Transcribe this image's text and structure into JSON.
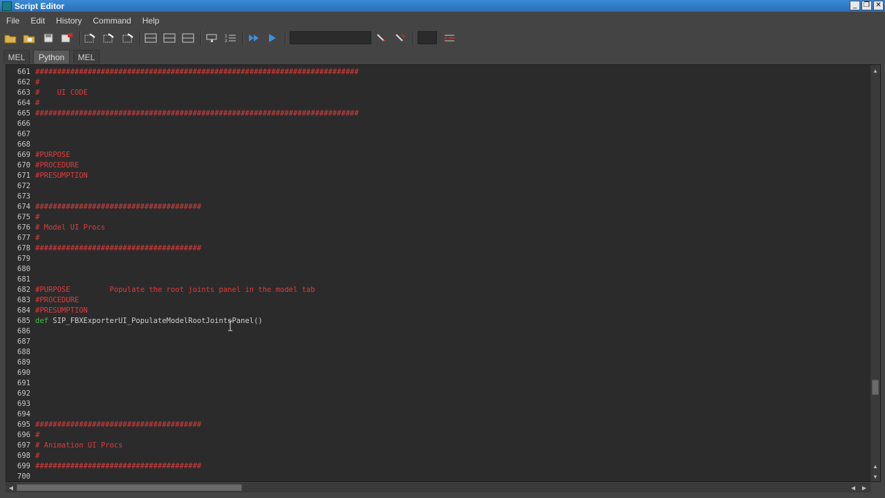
{
  "window": {
    "title": "Script Editor",
    "minimize": "_",
    "maximize": "❐",
    "close": "✕"
  },
  "menu": [
    "File",
    "Edit",
    "History",
    "Command",
    "Help"
  ],
  "tabs": [
    {
      "label": "MEL",
      "active": false
    },
    {
      "label": "Python",
      "active": true
    },
    {
      "label": "MEL",
      "active": false
    }
  ],
  "colors": {
    "comment": "#e03c3c",
    "keyword": "#3fbf3f",
    "background": "#2b2b2b"
  },
  "editor": {
    "lines": [
      {
        "n": "661",
        "t": "comment",
        "text": "##########################################################################"
      },
      {
        "n": "662",
        "t": "comment",
        "text": "#"
      },
      {
        "n": "663",
        "t": "comment",
        "text": "#    UI CODE"
      },
      {
        "n": "664",
        "t": "comment",
        "text": "#"
      },
      {
        "n": "665",
        "t": "comment",
        "text": "##########################################################################"
      },
      {
        "n": "666",
        "t": "comment",
        "text": ""
      },
      {
        "n": "667",
        "t": "comment",
        "text": ""
      },
      {
        "n": "668",
        "t": "comment",
        "text": ""
      },
      {
        "n": "669",
        "t": "comment",
        "text": "#PURPOSE"
      },
      {
        "n": "670",
        "t": "comment",
        "text": "#PROCEDURE"
      },
      {
        "n": "671",
        "t": "comment",
        "text": "#PRESUMPTION"
      },
      {
        "n": "672",
        "t": "comment",
        "text": ""
      },
      {
        "n": "673",
        "t": "comment",
        "text": ""
      },
      {
        "n": "674",
        "t": "comment",
        "text": "######################################"
      },
      {
        "n": "675",
        "t": "comment",
        "text": "#"
      },
      {
        "n": "676",
        "t": "comment",
        "text": "# Model UI Procs"
      },
      {
        "n": "677",
        "t": "comment",
        "text": "#"
      },
      {
        "n": "678",
        "t": "comment",
        "text": "######################################"
      },
      {
        "n": "679",
        "t": "comment",
        "text": ""
      },
      {
        "n": "680",
        "t": "comment",
        "text": ""
      },
      {
        "n": "681",
        "t": "comment",
        "text": ""
      },
      {
        "n": "682",
        "t": "comment",
        "text": "#PURPOSE         Populate the root joints panel in the model tab"
      },
      {
        "n": "683",
        "t": "comment",
        "text": "#PROCEDURE"
      },
      {
        "n": "684",
        "t": "comment",
        "text": "#PRESUMPTION"
      },
      {
        "n": "685",
        "t": "def",
        "kw": "def",
        "text": " SIP_FBXExporterUI_PopulateModelRootJointsPanel()"
      },
      {
        "n": "686",
        "t": "comment",
        "text": ""
      },
      {
        "n": "687",
        "t": "comment",
        "text": ""
      },
      {
        "n": "688",
        "t": "comment",
        "text": ""
      },
      {
        "n": "689",
        "t": "comment",
        "text": ""
      },
      {
        "n": "690",
        "t": "comment",
        "text": ""
      },
      {
        "n": "691",
        "t": "comment",
        "text": ""
      },
      {
        "n": "692",
        "t": "comment",
        "text": ""
      },
      {
        "n": "693",
        "t": "comment",
        "text": ""
      },
      {
        "n": "694",
        "t": "comment",
        "text": ""
      },
      {
        "n": "695",
        "t": "comment",
        "text": "######################################"
      },
      {
        "n": "696",
        "t": "comment",
        "text": "#"
      },
      {
        "n": "697",
        "t": "comment",
        "text": "# Animation UI Procs"
      },
      {
        "n": "698",
        "t": "comment",
        "text": "#"
      },
      {
        "n": "699",
        "t": "comment",
        "text": "######################################"
      },
      {
        "n": "700",
        "t": "comment",
        "text": ""
      }
    ]
  }
}
